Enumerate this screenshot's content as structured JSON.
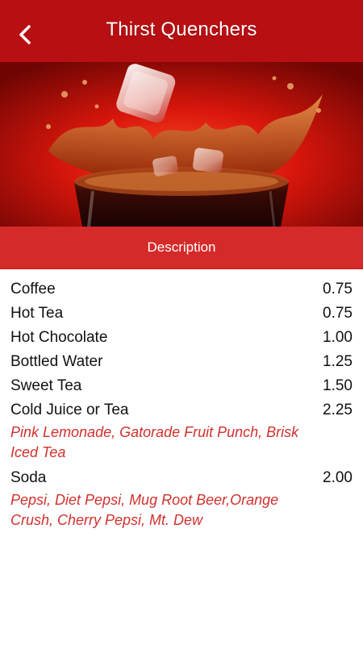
{
  "header": {
    "title": "Thirst Quenchers",
    "back_icon": "chevron-left-icon"
  },
  "colors": {
    "header_bg": "#b80f12",
    "description_bar_bg": "#d52a2a",
    "detail_text": "#d0312d"
  },
  "hero": {
    "image": "cola-glass-splash-with-ice-cube"
  },
  "description_bar": {
    "label": "Description"
  },
  "menu": {
    "items": [
      {
        "name": "Coffee",
        "price": "0.75",
        "detail": ""
      },
      {
        "name": "Hot Tea",
        "price": "0.75",
        "detail": ""
      },
      {
        "name": "Hot Chocolate",
        "price": "1.00",
        "detail": ""
      },
      {
        "name": "Bottled Water",
        "price": "1.25",
        "detail": ""
      },
      {
        "name": "Sweet Tea",
        "price": "1.50",
        "detail": ""
      },
      {
        "name": "Cold Juice or Tea",
        "price": "2.25",
        "detail": "Pink Lemonade, Gatorade Fruit Punch, Brisk Iced Tea"
      },
      {
        "name": "Soda",
        "price": "2.00",
        "detail": "Pepsi, Diet Pepsi, Mug Root Beer,Orange Crush, Cherry Pepsi, Mt. Dew"
      }
    ]
  }
}
